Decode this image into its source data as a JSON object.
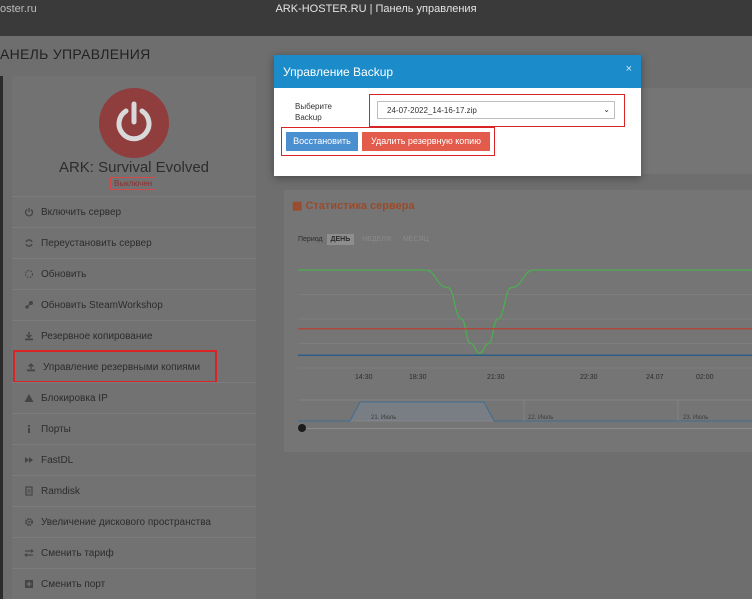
{
  "topbar": {
    "site": "oster.ru",
    "window_title": "ARK-HOSTER.RU | Панель управления"
  },
  "page": {
    "title": "АНЕЛЬ УПРАВЛЕНИЯ"
  },
  "server": {
    "name": "ARK: Survival Evolved",
    "status": "Выключен"
  },
  "sidebar": {
    "items": [
      {
        "label": "Включить сервер",
        "icon": "power-icon"
      },
      {
        "label": "Переустановить сервер",
        "icon": "refresh-icon"
      },
      {
        "label": "Обновить",
        "icon": "spinner-icon"
      },
      {
        "label": "Обновить SteamWorkshop",
        "icon": "steam-icon"
      },
      {
        "label": "Резервное копирование",
        "icon": "download-icon"
      },
      {
        "label": "Управление резервными копиями",
        "icon": "upload-icon"
      },
      {
        "label": "Блокировка IP",
        "icon": "warning-icon"
      },
      {
        "label": "Порты",
        "icon": "info-icon"
      },
      {
        "label": "FastDL",
        "icon": "fast-forward-icon"
      },
      {
        "label": "Ramdisk",
        "icon": "file-icon"
      },
      {
        "label": "Увеличение дискового пространства",
        "icon": "gear-icon"
      },
      {
        "label": "Сменить тариф",
        "icon": "swap-icon"
      },
      {
        "label": "Сменить порт",
        "icon": "plus-square-icon"
      }
    ]
  },
  "stats": {
    "title": "Статистика сервера",
    "period_label": "Период",
    "periods": [
      "ДЕНЬ",
      "НЕДЕЛЯ",
      "МЕСЯЦ"
    ],
    "active_period": "ДЕНЬ",
    "x_ticks": [
      "14:30",
      "18:30",
      "21:30",
      "22:30",
      "24.07",
      "02:00"
    ],
    "navigator_labels": [
      "21. Июль",
      "22. Июль",
      "23. Июль"
    ]
  },
  "chart_data": {
    "type": "line",
    "x_ticks": [
      "14:30",
      "18:30",
      "21:30",
      "22:30",
      "24.07",
      "02:00"
    ],
    "series": [
      {
        "color": "#4caf50",
        "points": [
          [
            0,
            1
          ],
          [
            0.28,
            1
          ],
          [
            0.33,
            0.82
          ],
          [
            0.36,
            0.5
          ],
          [
            0.38,
            0.25
          ],
          [
            0.4,
            0.15
          ],
          [
            0.42,
            0.25
          ],
          [
            0.44,
            0.5
          ],
          [
            0.47,
            0.82
          ],
          [
            0.52,
            1
          ],
          [
            1,
            1
          ]
        ]
      },
      {
        "color": "#c0392b",
        "points": [
          [
            0,
            0.4
          ],
          [
            1,
            0.4
          ]
        ]
      },
      {
        "color": "#1f5a8a",
        "points": [
          [
            0,
            0.13
          ],
          [
            1,
            0.13
          ]
        ]
      }
    ],
    "grid": true
  },
  "modal": {
    "title": "Управление Backup",
    "close": "×",
    "field_label": "Выберите Backup",
    "selected_backup": "24-07-2022_14-16-17.zip",
    "restore_label": "Восстановить",
    "delete_label": "Удалить резервную копию"
  }
}
